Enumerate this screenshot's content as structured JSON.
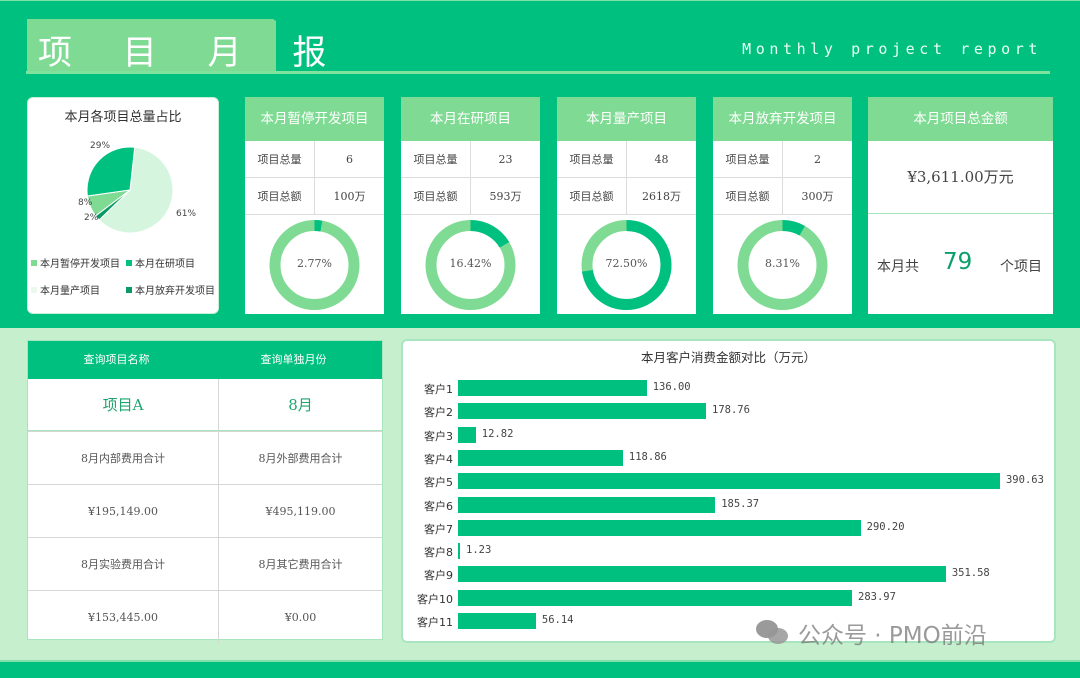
{
  "header": {
    "title": "项 目 月 报",
    "subtitle": "Monthly project report"
  },
  "colors": {
    "primary": "#00c07f",
    "light": "#7fdb93",
    "pale": "#d6f5df",
    "dark": "#0a9a66",
    "panel_bg": "#c6efcd"
  },
  "pie": {
    "title": "本月各项目总量占比",
    "slices": [
      {
        "label": "本月暂停开发项目",
        "percent": 8,
        "display": "8%",
        "color": "#7fdb93"
      },
      {
        "label": "本月在研项目",
        "percent": 29,
        "display": "29%",
        "color": "#00c07f"
      },
      {
        "label": "本月量产项目",
        "percent": 61,
        "display": "61%",
        "color": "#d6f5df"
      },
      {
        "label": "本月放弃开发项目",
        "percent": 2,
        "display": "2%",
        "color": "#0a9a66"
      }
    ]
  },
  "stat_cards": [
    {
      "title": "本月暂停开发项目",
      "count_label": "项目总量",
      "count": "6",
      "amount_label": "项目总额",
      "amount": "100万",
      "percent": 2.77,
      "percent_text": "2.77%"
    },
    {
      "title": "本月在研项目",
      "count_label": "项目总量",
      "count": "23",
      "amount_label": "项目总额",
      "amount": "593万",
      "percent": 16.42,
      "percent_text": "16.42%"
    },
    {
      "title": "本月量产项目",
      "count_label": "项目总量",
      "count": "48",
      "amount_label": "项目总额",
      "amount": "2618万",
      "percent": 72.5,
      "percent_text": "72.50%"
    },
    {
      "title": "本月放弃开发项目",
      "count_label": "项目总量",
      "count": "2",
      "amount_label": "项目总额",
      "amount": "300万",
      "percent": 8.31,
      "percent_text": "8.31%"
    }
  ],
  "total": {
    "title": "本月项目总金额",
    "amount": "¥3,611.00万元",
    "prefix": "本月共",
    "count": "79",
    "suffix": "个项目"
  },
  "query": {
    "headers": [
      "查询项目名称",
      "查询单独月份"
    ],
    "selected": [
      "项目A",
      "8月"
    ],
    "rows": [
      [
        "8月内部费用合计",
        "8月外部费用合计"
      ],
      [
        "¥195,149.00",
        "¥495,119.00"
      ],
      [
        "8月实验费用合计",
        "8月其它费用合计"
      ],
      [
        "¥153,445.00",
        "¥0.00"
      ]
    ]
  },
  "chart_data": {
    "type": "bar",
    "orientation": "horizontal",
    "title": "本月客户消费金额对比（万元）",
    "categories": [
      "客户1",
      "客户2",
      "客户3",
      "客户4",
      "客户5",
      "客户6",
      "客户7",
      "客户8",
      "客户9",
      "客户10",
      "客户11"
    ],
    "values": [
      136.0,
      178.76,
      12.82,
      118.86,
      390.63,
      185.37,
      290.2,
      1.23,
      351.58,
      283.97,
      56.14
    ],
    "labels": [
      "136.00",
      "178.76",
      "12.82",
      "118.86",
      "390.63",
      "185.37",
      "290.20",
      "1.23",
      "351.58",
      "283.97",
      "56.14"
    ],
    "xlabel": "",
    "ylabel": "",
    "xlim": [
      0,
      400
    ],
    "grid": false,
    "legend": "none"
  },
  "watermark": "公众号 · PMO前沿"
}
